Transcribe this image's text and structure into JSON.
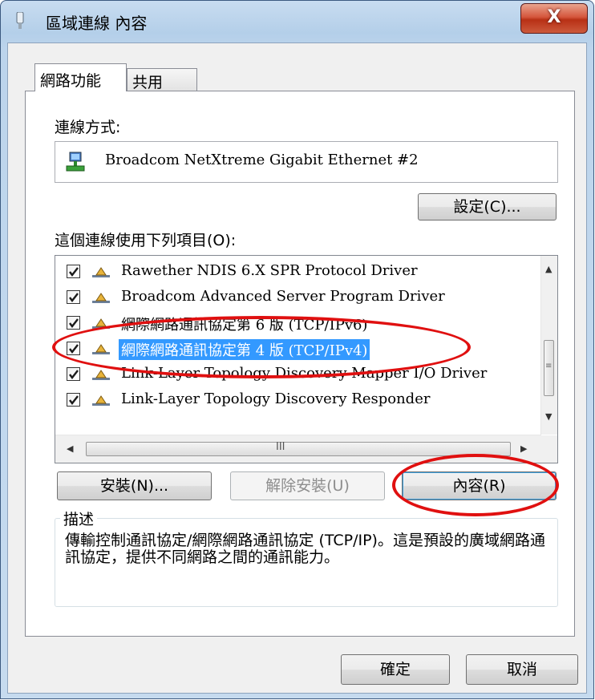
{
  "window": {
    "title": "區域連線 內容",
    "close_label": "X"
  },
  "tabs": [
    {
      "label": "網路功能"
    },
    {
      "label": "共用"
    }
  ],
  "connection": {
    "label": "連線方式:",
    "adapter_name": "Broadcom NetXtreme Gigabit Ethernet #2",
    "configure_button": "設定(C)..."
  },
  "items": {
    "label": "這個連線使用下列項目(O):",
    "list": [
      {
        "label": "Rawether NDIS 6.X SPR Protocol Driver",
        "checked": true
      },
      {
        "label": "Broadcom Advanced Server Program Driver",
        "checked": true
      },
      {
        "label": "網際網路通訊協定第 6 版 (TCP/IPv6)",
        "checked": true
      },
      {
        "label": "網際網路通訊協定第 4 版 (TCP/IPv4)",
        "checked": true,
        "selected": true
      },
      {
        "label": "Link-Layer Topology Discovery Mapper I/O Driver",
        "checked": true
      },
      {
        "label": "Link-Layer Topology Discovery Responder",
        "checked": true
      }
    ],
    "hscroll_grip": "III"
  },
  "buttons": {
    "install": "安裝(N)...",
    "uninstall": "解除安裝(U)",
    "properties": "內容(R)"
  },
  "description": {
    "legend": "描述",
    "text": "傳輸控制通訊協定/網際網路通訊協定 (TCP/IP)。這是預設的廣域網路通訊協定，提供不同網路之間的通訊能力。"
  },
  "footer": {
    "ok": "確定",
    "cancel": "取消"
  },
  "colors": {
    "highlight": "#3399ff",
    "annotation": "#e01010",
    "close_button": "#c8462c"
  },
  "icons": [
    "network-adapter-icon",
    "protocol-icon",
    "close-icon",
    "checkbox-check-icon"
  ]
}
